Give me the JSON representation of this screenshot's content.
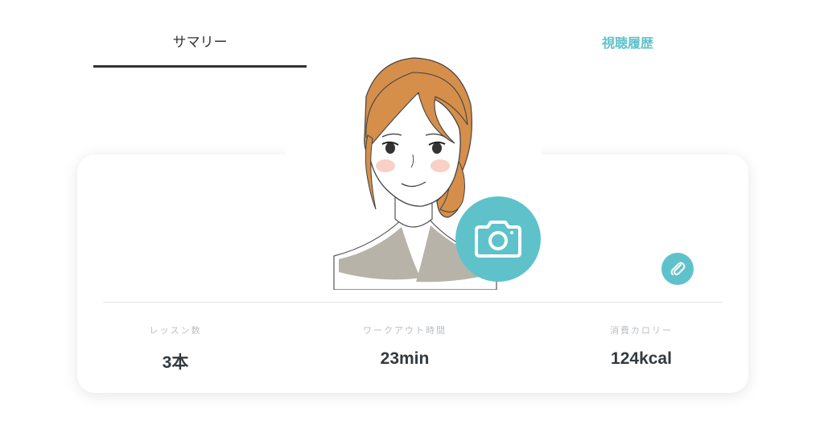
{
  "tabs": {
    "summary": "サマリー",
    "history": "視聴履歴"
  },
  "stats": [
    {
      "label": "レッスン数",
      "value": "3本"
    },
    {
      "label": "ワークアウト時間",
      "value": "23min"
    },
    {
      "label": "消費カロリー",
      "value": "124kcal"
    }
  ],
  "icons": {
    "camera": "camera-icon",
    "edit": "paperclip-icon"
  },
  "colors": {
    "accent": "#5fc2cb",
    "text_dark": "#333a3f",
    "label_gray": "#b9bec3"
  }
}
